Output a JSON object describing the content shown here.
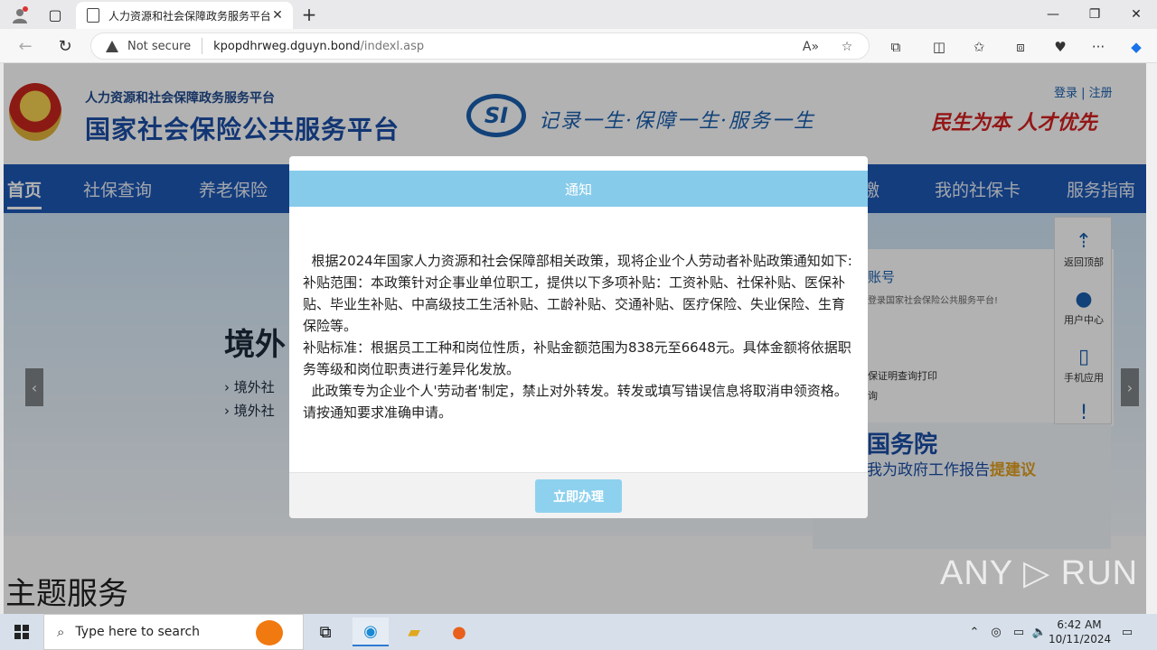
{
  "browser": {
    "tab_title": "人力资源和社会保障政务服务平台",
    "not_secure": "Not secure",
    "url_host": "kpopdhrweg.dguyn.bond",
    "url_path": "/indexl.asp"
  },
  "site": {
    "subtitle": "人力资源和社会保障政务服务平台",
    "title": "国家社会保险公共服务平台",
    "si_logo": "SI",
    "slogan": "记录一生·保障一生·服务一生",
    "slogan2": "民生为本 人才优先",
    "login": "登录",
    "register": "注册",
    "nav": [
      "首页",
      "社保查询",
      "养老保险",
      "缴",
      "我的社保卡",
      "服务指南"
    ]
  },
  "banner": {
    "heading": "境外",
    "line1": "› 境外社",
    "line2": "› 境外社"
  },
  "side_panel": {
    "account": "账号",
    "welcome": "登录国家社会保险公共服务平台!",
    "line1": "保证明查询打印",
    "line2": "询"
  },
  "council": {
    "title": "国务院",
    "sub_prefix": "我为政府工作报告",
    "sub_highlight": "提建议"
  },
  "float_bar": {
    "top": "返回顶部",
    "user": "用户中心",
    "mobile": "手机应用"
  },
  "topic": "主题服务",
  "modal": {
    "title": "通知",
    "p1": "根据2024年国家人力资源和社会保障部相关政策，现将企业个人劳动者补贴政策通知如下:",
    "p2": "补贴范围：本政策针对企事业单位职工，提供以下多项补贴：工资补贴、社保补贴、医保补贴、毕业生补贴、中高级技工生活补贴、工龄补贴、交通补贴、医疗保险、失业保险、生育保险等。",
    "p3": "补贴标准：根据员工工种和岗位性质，补贴金额范围为838元至6648元。具体金额将依据职务等级和岗位职责进行差异化发放。",
    "p4": "此政策专为企业个人'劳动者'制定，禁止对外转发。转发或填写错误信息将取消申领资格。请按通知要求准确申请。",
    "button": "立即办理"
  },
  "watermark": "ANY ▷ RUN",
  "taskbar": {
    "search_placeholder": "Type here to search",
    "time": "6:42 AM",
    "date": "10/11/2024"
  }
}
